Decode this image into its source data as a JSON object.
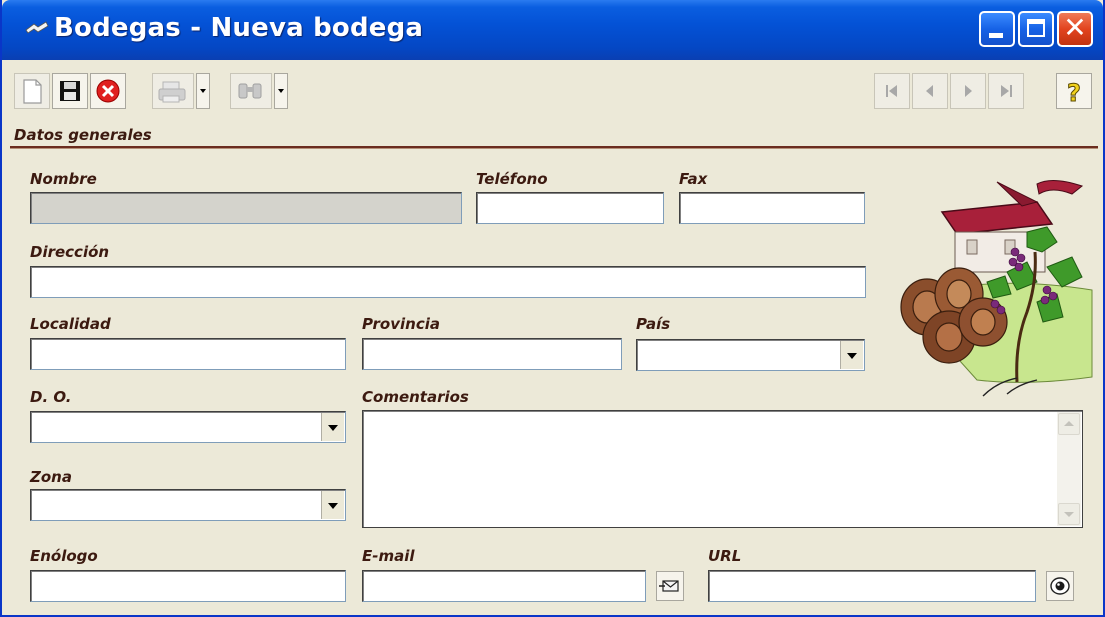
{
  "window": {
    "title": "Bodegas - Nueva bodega",
    "controls": {
      "minimize": "minimize-icon",
      "maximize": "maximize-icon",
      "close": "close-icon"
    }
  },
  "toolbar": {
    "buttons": [
      "new-document-icon",
      "save-icon",
      "cancel-icon",
      "print-icon",
      "search-binoculars-icon"
    ],
    "navigation": [
      "first-record-icon",
      "previous-record-icon",
      "next-record-icon",
      "last-record-icon"
    ],
    "help": "help-icon"
  },
  "section": {
    "title": "Datos generales"
  },
  "form": {
    "nombre": {
      "label": "Nombre",
      "value": ""
    },
    "telefono": {
      "label": "Teléfono",
      "value": ""
    },
    "fax": {
      "label": "Fax",
      "value": ""
    },
    "direccion": {
      "label": "Dirección",
      "value": ""
    },
    "localidad": {
      "label": "Localidad",
      "value": ""
    },
    "provincia": {
      "label": "Provincia",
      "value": ""
    },
    "pais": {
      "label": "País",
      "value": ""
    },
    "do": {
      "label": "D. O.",
      "value": ""
    },
    "zona": {
      "label": "Zona",
      "value": ""
    },
    "comentarios": {
      "label": "Comentarios",
      "value": ""
    },
    "enologo": {
      "label": "Enólogo",
      "value": ""
    },
    "email": {
      "label": "E-mail",
      "value": ""
    },
    "url": {
      "label": "URL",
      "value": ""
    }
  },
  "icons": {
    "send_email": "send-email-icon",
    "view_url": "view-eye-icon",
    "illustration": "winery-illustration"
  },
  "colors": {
    "titlebar": "#0452d6",
    "window_bg": "#ece9d8",
    "label": "#3c1a10",
    "rule": "#6b2d1f"
  }
}
